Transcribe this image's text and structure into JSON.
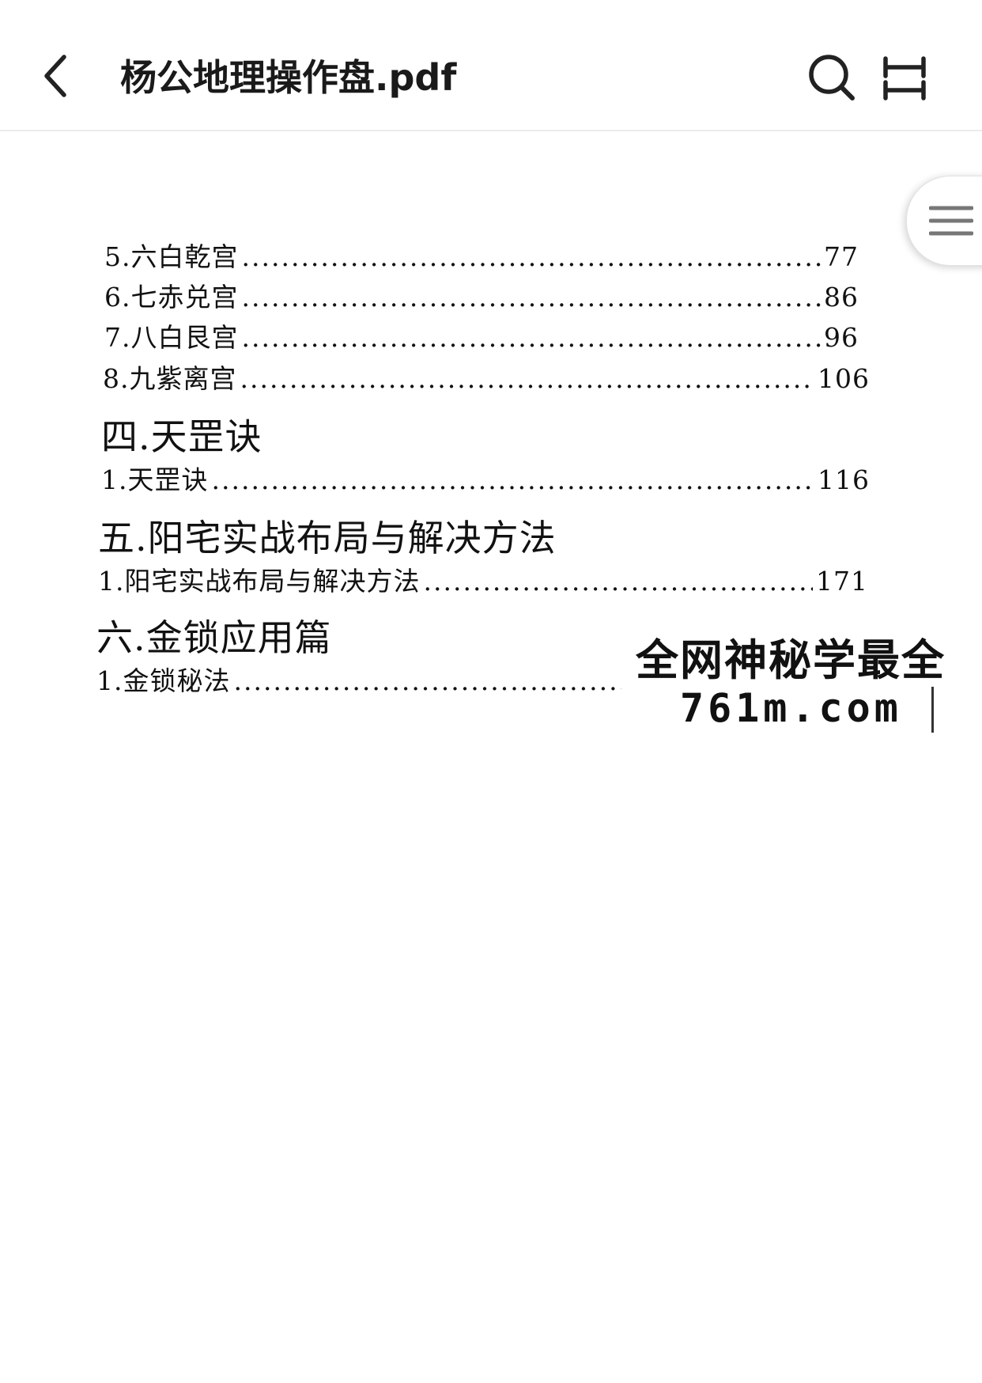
{
  "header": {
    "title": "杨公地理操作盘.pdf",
    "back_icon": "chevron-left-icon",
    "search_icon": "search-icon",
    "fullscreen_icon": "fullscreen-icon"
  },
  "toc_button": {
    "icon": "menu-icon"
  },
  "toc": {
    "entries": [
      {
        "label": "5.六白乾宫",
        "page": "77"
      },
      {
        "label": "6.七赤兑宫",
        "page": "86"
      },
      {
        "label": "7.八白艮宫",
        "page": "96"
      },
      {
        "label": "8.九紫离宫",
        "page": "106"
      }
    ],
    "sections": [
      {
        "heading": "四.天罡诀",
        "entries": [
          {
            "label": "1.天罡诀",
            "page": "116"
          }
        ]
      },
      {
        "heading": "五.阳宅实战布局与解决方法",
        "entries": [
          {
            "label": "1.阳宅实战布局与解决方法",
            "page": "171"
          }
        ]
      },
      {
        "heading": "六.金锁应用篇",
        "entries": [
          {
            "label": "1.金锁秘法",
            "page": ""
          }
        ]
      }
    ]
  },
  "watermark": {
    "line1": "全网神秘学最全",
    "line2": "761m.com"
  }
}
